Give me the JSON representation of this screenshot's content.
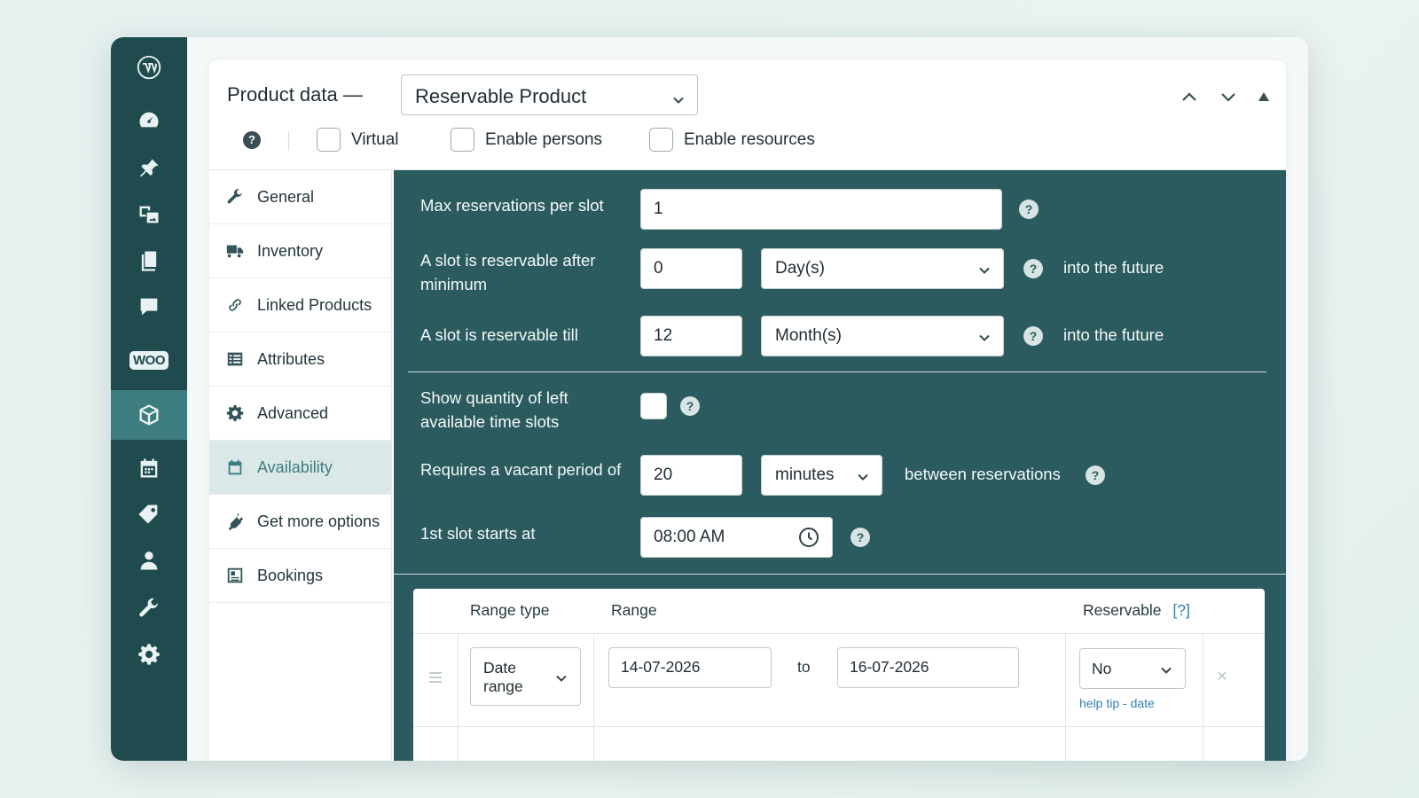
{
  "header": {
    "title": "Product data —",
    "product_type": "Reservable Product",
    "options": [
      {
        "label": "Virtual",
        "checked": false
      },
      {
        "label": "Enable persons",
        "checked": false
      },
      {
        "label": "Enable resources",
        "checked": false
      }
    ],
    "help_glyph": "?"
  },
  "wp_menu": [
    {
      "name": "wordpress-logo-icon",
      "active": false
    },
    {
      "name": "dashboard-icon",
      "active": false
    },
    {
      "name": "posts-pin-icon",
      "active": false
    },
    {
      "name": "media-icon",
      "active": false
    },
    {
      "name": "pages-icon",
      "active": false
    },
    {
      "name": "comments-icon",
      "active": false
    },
    {
      "name": "woocommerce-icon",
      "label": "WOO",
      "active": false
    },
    {
      "name": "products-box-icon",
      "active": true
    },
    {
      "name": "bookings-calendar-icon",
      "active": false
    },
    {
      "name": "marketing-tag-icon",
      "active": false
    },
    {
      "name": "users-icon",
      "active": false
    },
    {
      "name": "tools-wrench-icon",
      "active": false
    },
    {
      "name": "settings-gear-icon",
      "active": false
    }
  ],
  "tabs": [
    {
      "label": "General",
      "icon": "wrench-icon",
      "active": false
    },
    {
      "label": "Inventory",
      "icon": "truck-icon",
      "active": false
    },
    {
      "label": "Linked Products",
      "icon": "link-icon",
      "active": false
    },
    {
      "label": "Attributes",
      "icon": "list-icon",
      "active": false
    },
    {
      "label": "Advanced",
      "icon": "gear-icon",
      "active": false
    },
    {
      "label": "Availability",
      "icon": "calendar-icon",
      "active": true
    },
    {
      "label": "Get more options",
      "icon": "plug-icon",
      "active": false
    },
    {
      "label": "Bookings",
      "icon": "bookings-icon",
      "active": false
    }
  ],
  "fields": {
    "max_reservations": {
      "label": "Max reservations per slot",
      "value": "1"
    },
    "min_after": {
      "label_line1": "A slot is reservable after",
      "label_line2": "minimum",
      "value": "0",
      "unit": "Day(s)",
      "suffix": "into the future"
    },
    "till": {
      "label": "A slot is reservable till",
      "value": "12",
      "unit": "Month(s)",
      "suffix": "into the future"
    },
    "show_quantity": {
      "label_line1": "Show quantity of left",
      "label_line2": "available time slots",
      "checked": false
    },
    "vacant_period": {
      "label": "Requires a vacant period of",
      "value": "20",
      "unit": "minutes",
      "suffix": "between reservations"
    },
    "first_slot": {
      "label": "1st slot starts at",
      "value": "08:00 AM"
    }
  },
  "ranges_table": {
    "headers": {
      "range_type": "Range type",
      "range": "Range",
      "reservable": "Reservable",
      "reservable_help": "[?]"
    },
    "rows": [
      {
        "range_type_line1": "Date",
        "range_type_line2": "range",
        "from": "14-07-2026",
        "to_label": "to",
        "to": "16-07-2026",
        "reservable": "No",
        "help_tip": "help tip - date",
        "remove": "×"
      }
    ]
  },
  "colors": {
    "sidebar": "#1f4b4f",
    "sidebar_active": "#3d7d80",
    "content_bg": "#2b5b5f",
    "link": "#2f7fb2"
  }
}
